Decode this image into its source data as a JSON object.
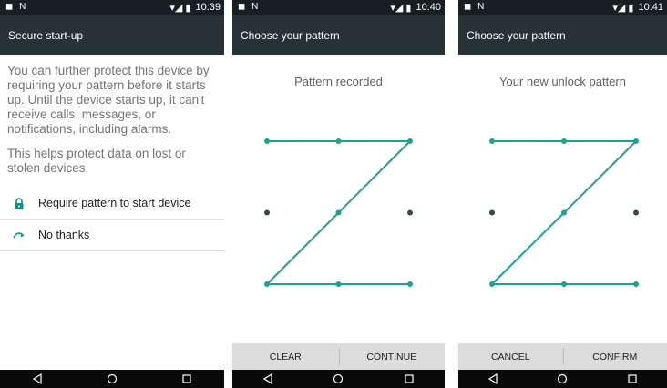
{
  "screens": [
    {
      "status": {
        "left_icons": "◼ N",
        "right_icons": "▾◢ ▮",
        "time": "10:39"
      },
      "title": "Secure start-up",
      "description": [
        "You can further protect this device by requiring your pattern before it starts up. Until the device starts up, it can't receive calls, messages, or notifications, including alarms.",
        "This helps protect data on lost or stolen devices."
      ],
      "options": [
        {
          "label": "Require pattern to start device",
          "icon": "lock-icon"
        },
        {
          "label": "No thanks",
          "icon": "redirect-arrow-icon"
        }
      ]
    },
    {
      "status": {
        "left_icons": "◼ N",
        "right_icons": "▾◢ ▮",
        "time": "10:40"
      },
      "title": "Choose your pattern",
      "message": "Pattern recorded",
      "buttons": {
        "left": "CLEAR",
        "right": "CONTINUE"
      }
    },
    {
      "status": {
        "left_icons": "◼ N",
        "right_icons": "▾◢ ▮",
        "time": "10:41"
      },
      "title": "Choose your pattern",
      "message": "Your new unlock pattern",
      "buttons": {
        "left": "CANCEL",
        "right": "CONFIRM"
      }
    }
  ],
  "pattern": {
    "grid": "3x3",
    "sequence": [
      1,
      2,
      3,
      5,
      7,
      8,
      9
    ],
    "line_color": "#1ba293",
    "inactive_dot_color": "#37474f"
  },
  "colors": {
    "status_bar": "#171f23",
    "app_bar": "#263238",
    "accent": "#009688",
    "button_bar": "#dcdcdc",
    "nav_bar": "#0a0a0a"
  },
  "nav_icons": [
    "back-icon",
    "home-icon",
    "recents-icon"
  ]
}
